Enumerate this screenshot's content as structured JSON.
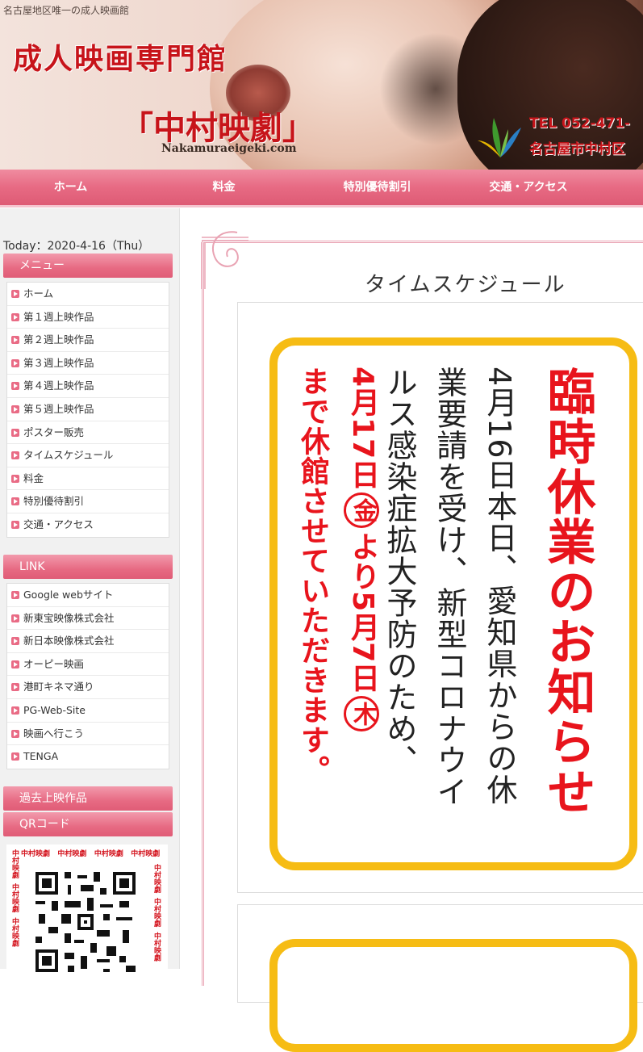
{
  "header": {
    "tagline": "名古屋地区唯一の成人映画館",
    "subtitle": "成人映画専門館",
    "title": "「中村映劇」",
    "url": "Nakamuraeigeki.com",
    "tel": "TEL 052-471-",
    "address": "名古屋市中村区"
  },
  "nav": {
    "items": [
      "ホーム",
      "料金",
      "特別優待割引",
      "交通・アクセス"
    ]
  },
  "sidebar": {
    "today": "Today：2020-4-16（Thu）",
    "menu_heading": "メニュー",
    "menu": [
      "ホーム",
      "第１週上映作品",
      "第２週上映作品",
      "第３週上映作品",
      "第４週上映作品",
      "第５週上映作品",
      "ポスター販売",
      "タイムスケジュール",
      "料金",
      "特別優待割引",
      "交通・アクセス"
    ],
    "link_heading": "LINK",
    "links": [
      "Google webサイト",
      "新東宝映像株式会社",
      "新日本映像株式会社",
      "オーピー映画",
      "港町キネマ通り",
      "PG-Web-Site",
      "映画へ行こう",
      "TENGA"
    ],
    "past_heading": "過去上映作品",
    "qr_heading": "QRコード",
    "qr_text": "中村映劇"
  },
  "main": {
    "page_title": "タイムスケジュール",
    "notice_title": "臨時休業のお知らせ",
    "notice_body": [
      "4月16日本日、愛知県からの休",
      "業要請を受け、新型コロナウイ",
      "ルス感染症拡大予防のため、"
    ],
    "notice_red": [
      "4月17日",
      "金",
      "より5月7日",
      "木",
      "まで休館させていただきます。"
    ]
  },
  "colors": {
    "brand_red": "#c7141a",
    "nav_pink": "#e76a83",
    "notice_border": "#f6bc14",
    "notice_red": "#e8141c"
  }
}
